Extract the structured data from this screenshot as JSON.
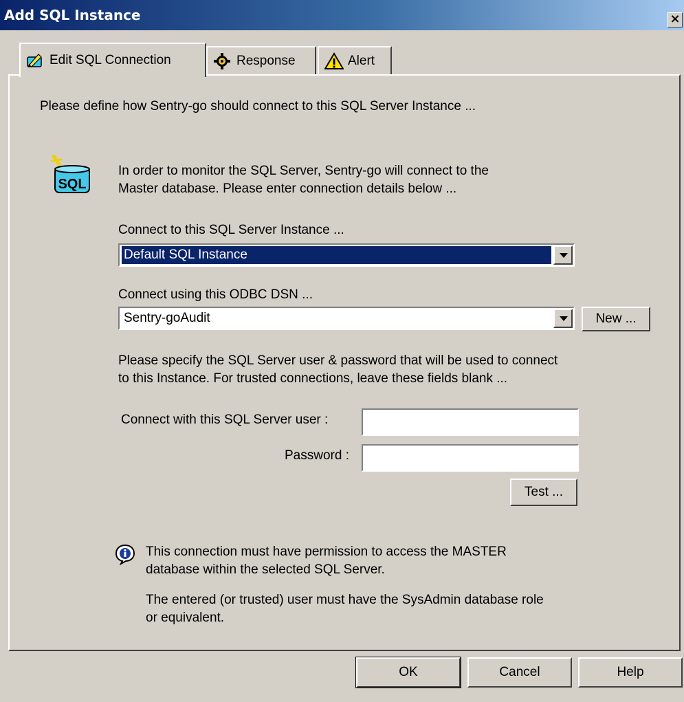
{
  "window": {
    "title": "Add SQL Instance",
    "close_glyph": "×"
  },
  "tabs": [
    {
      "label": "Edit SQL Connection",
      "icon": "edit-connection-icon"
    },
    {
      "label": "Response",
      "icon": "response-gear-icon"
    },
    {
      "label": "Alert",
      "icon": "alert-warning-icon"
    }
  ],
  "content": {
    "intro": "Please define how Sentry-go should connect to this SQL Server Instance ...",
    "sql_icon_text": "SQL",
    "desc_line1": "In order to monitor the SQL Server, Sentry-go will connect to the",
    "desc_line2": "Master database. Please enter connection details below ...",
    "instance_label": "Connect to this SQL Server Instance ...",
    "instance_value": "Default SQL Instance",
    "dsn_label": "Connect using this ODBC DSN ...",
    "dsn_value": "Sentry-goAudit",
    "new_button": "New ...",
    "cred_line1": "Please specify the SQL Server user & password that will be used to connect",
    "cred_line2": "to this Instance. For trusted connections, leave these fields blank ...",
    "user_label": "Connect with this SQL Server user :",
    "user_value": "",
    "password_label": "Password :",
    "password_value": "",
    "test_button": "Test ...",
    "note1_line1": "This connection must have permission to access the MASTER",
    "note1_line2": "database within the selected SQL Server.",
    "note2_line1": "The entered (or trusted) user must have the SysAdmin database role",
    "note2_line2": "or equivalent."
  },
  "footer": {
    "ok": "OK",
    "cancel": "Cancel",
    "help": "Help"
  }
}
